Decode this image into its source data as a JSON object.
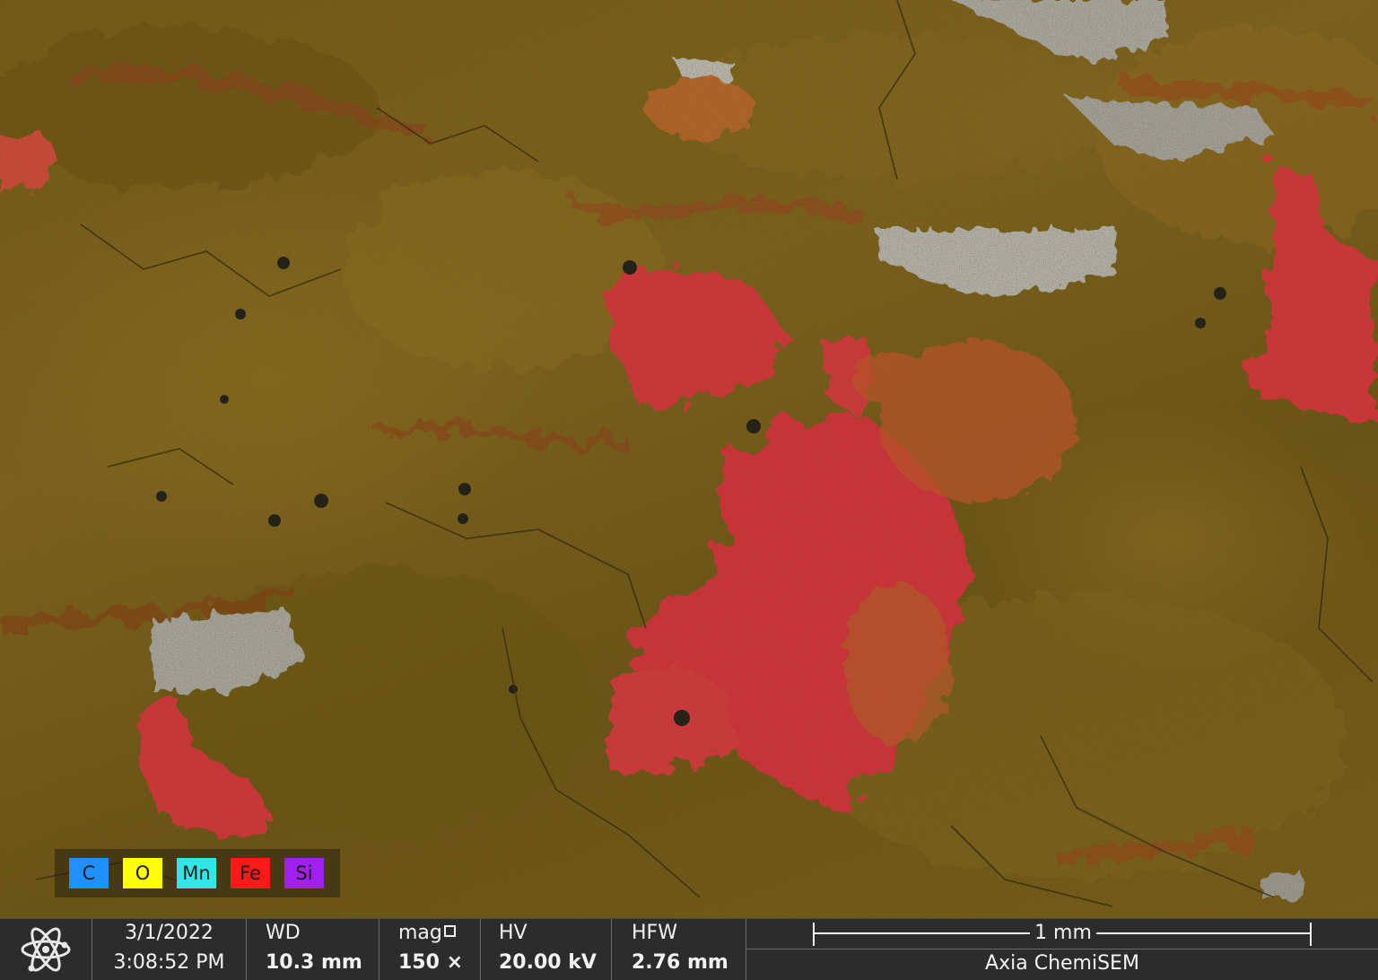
{
  "legend": {
    "elements": [
      {
        "symbol": "C",
        "color": "#1e90ff"
      },
      {
        "symbol": "O",
        "color": "#ffff00"
      },
      {
        "symbol": "Mn",
        "color": "#33e6e6"
      },
      {
        "symbol": "Fe",
        "color": "#ff1a1a"
      },
      {
        "symbol": "Si",
        "color": "#a020f0"
      }
    ]
  },
  "databar": {
    "logo_icon": "atom-icon",
    "date": "3/1/2022",
    "time": "3:08:52 PM",
    "wd_label": "WD",
    "wd_value": "10.3 mm",
    "mag_label": "mag",
    "mag_icon": "square-icon",
    "mag_value": "150 ×",
    "hv_label": "HV",
    "hv_value": "20.00 kV",
    "hfw_label": "HFW",
    "hfw_value": "2.76 mm",
    "scale_bar_label": "1 mm",
    "instrument_name": "Axia ChemiSEM"
  },
  "colors": {
    "background_ochre": "#7d5f15",
    "iron_red": "#f0303c",
    "silicon_gray": "#c8c8c8",
    "bar_bg": "#2c2c2c",
    "bar_text": "#f2f2f2"
  }
}
